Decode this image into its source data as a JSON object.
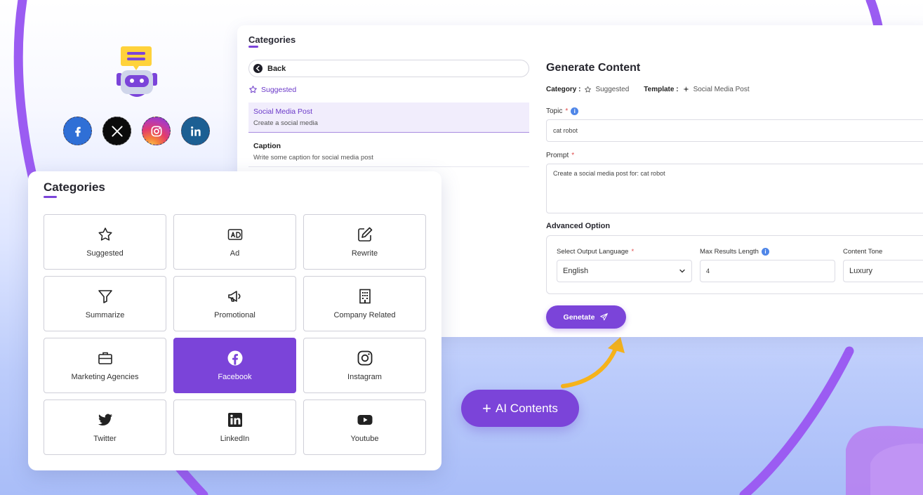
{
  "colors": {
    "accent": "#7b44d9",
    "accent_light": "#f1edfc",
    "info": "#4f86e8",
    "required": "#e04a4a",
    "arrow": "#f6b31a"
  },
  "branding": {
    "robot_icon": "robot-chat-icon",
    "socials": [
      {
        "name": "facebook-icon"
      },
      {
        "name": "x-icon"
      },
      {
        "name": "instagram-icon"
      },
      {
        "name": "linkedin-icon"
      }
    ]
  },
  "panel": {
    "title": "Categories",
    "back_label": "Back",
    "suggested_label": "Suggested",
    "templates": [
      {
        "title": "Social Media Post",
        "desc": "Create a social media"
      },
      {
        "title": "Caption",
        "desc": "Write some caption for social media post"
      }
    ],
    "generate": {
      "title": "Generate Content",
      "category_label": "Category :",
      "category_value": "Suggested",
      "template_label": "Template :",
      "template_value": "Social Media Post",
      "topic_label": "Topic",
      "topic_value": "cat robot",
      "prompt_label": "Prompt",
      "prompt_value": "Create a social media post for: cat robot",
      "advanced_label": "Advanced Option",
      "language_label": "Select Output Language",
      "language_value": "English",
      "max_length_label": "Max Results Length",
      "max_length_value": "4",
      "tone_label": "Content Tone",
      "tone_value": "Luxury",
      "button_label": "Genetate"
    }
  },
  "categories_card": {
    "title": "Categories",
    "items": [
      {
        "label": "Suggested",
        "icon": "star-icon"
      },
      {
        "label": "Ad",
        "icon": "ad-icon"
      },
      {
        "label": "Rewrite",
        "icon": "edit-icon"
      },
      {
        "label": "Summarize",
        "icon": "filter-icon"
      },
      {
        "label": "Promotional",
        "icon": "megaphone-icon"
      },
      {
        "label": "Company Related",
        "icon": "building-icon"
      },
      {
        "label": "Marketing Agencies",
        "icon": "briefcase-icon"
      },
      {
        "label": "Facebook",
        "icon": "facebook-icon",
        "active": true
      },
      {
        "label": "Instagram",
        "icon": "instagram-icon"
      },
      {
        "label": "Twitter",
        "icon": "twitter-icon"
      },
      {
        "label": "LinkedIn",
        "icon": "linkedin-icon"
      },
      {
        "label": "Youtube",
        "icon": "youtube-icon"
      }
    ]
  },
  "cta": {
    "plus": "+",
    "label": "AI Contents"
  }
}
